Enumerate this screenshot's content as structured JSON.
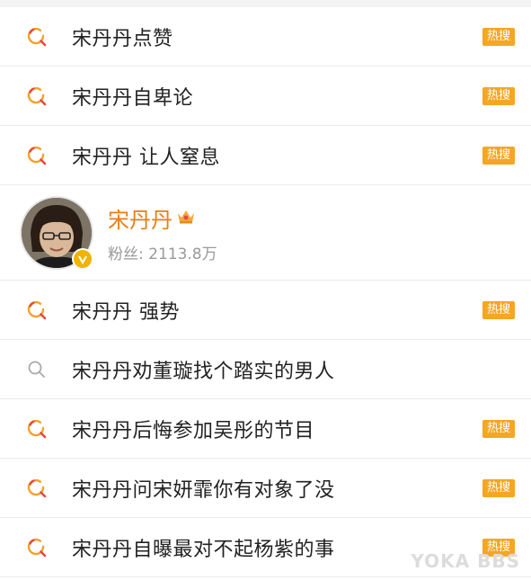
{
  "colors": {
    "accent_orange": "#f5a623",
    "hot_icon_orange": "#f4a12a",
    "hot_icon_red": "#e8483c",
    "name_orange": "#eb7d13"
  },
  "search_items_top": [
    {
      "text": "宋丹丹点赞",
      "badge": "热搜",
      "icon": "hot-search-icon"
    },
    {
      "text": "宋丹丹自卑论",
      "badge": "热搜",
      "icon": "hot-search-icon"
    },
    {
      "text": "宋丹丹 让人窒息",
      "badge": "热搜",
      "icon": "hot-search-icon"
    }
  ],
  "user": {
    "name": "宋丹丹",
    "fans": "粉丝: 2113.8万",
    "icon": "crown-icon"
  },
  "search_items_bottom": [
    {
      "text": "宋丹丹 强势",
      "badge": "热搜",
      "icon": "hot-search-icon"
    },
    {
      "text": "宋丹丹劝董璇找个踏实的男人",
      "badge": "",
      "icon": "search-icon"
    },
    {
      "text": "宋丹丹后悔参加吴彤的节目",
      "badge": "热搜",
      "icon": "hot-search-icon"
    },
    {
      "text": "宋丹丹问宋妍霏你有对象了没",
      "badge": "热搜",
      "icon": "hot-search-icon"
    },
    {
      "text": "宋丹丹自曝最对不起杨紫的事",
      "badge": "热搜",
      "icon": "hot-search-icon"
    }
  ],
  "watermark": "YOKA BBS"
}
